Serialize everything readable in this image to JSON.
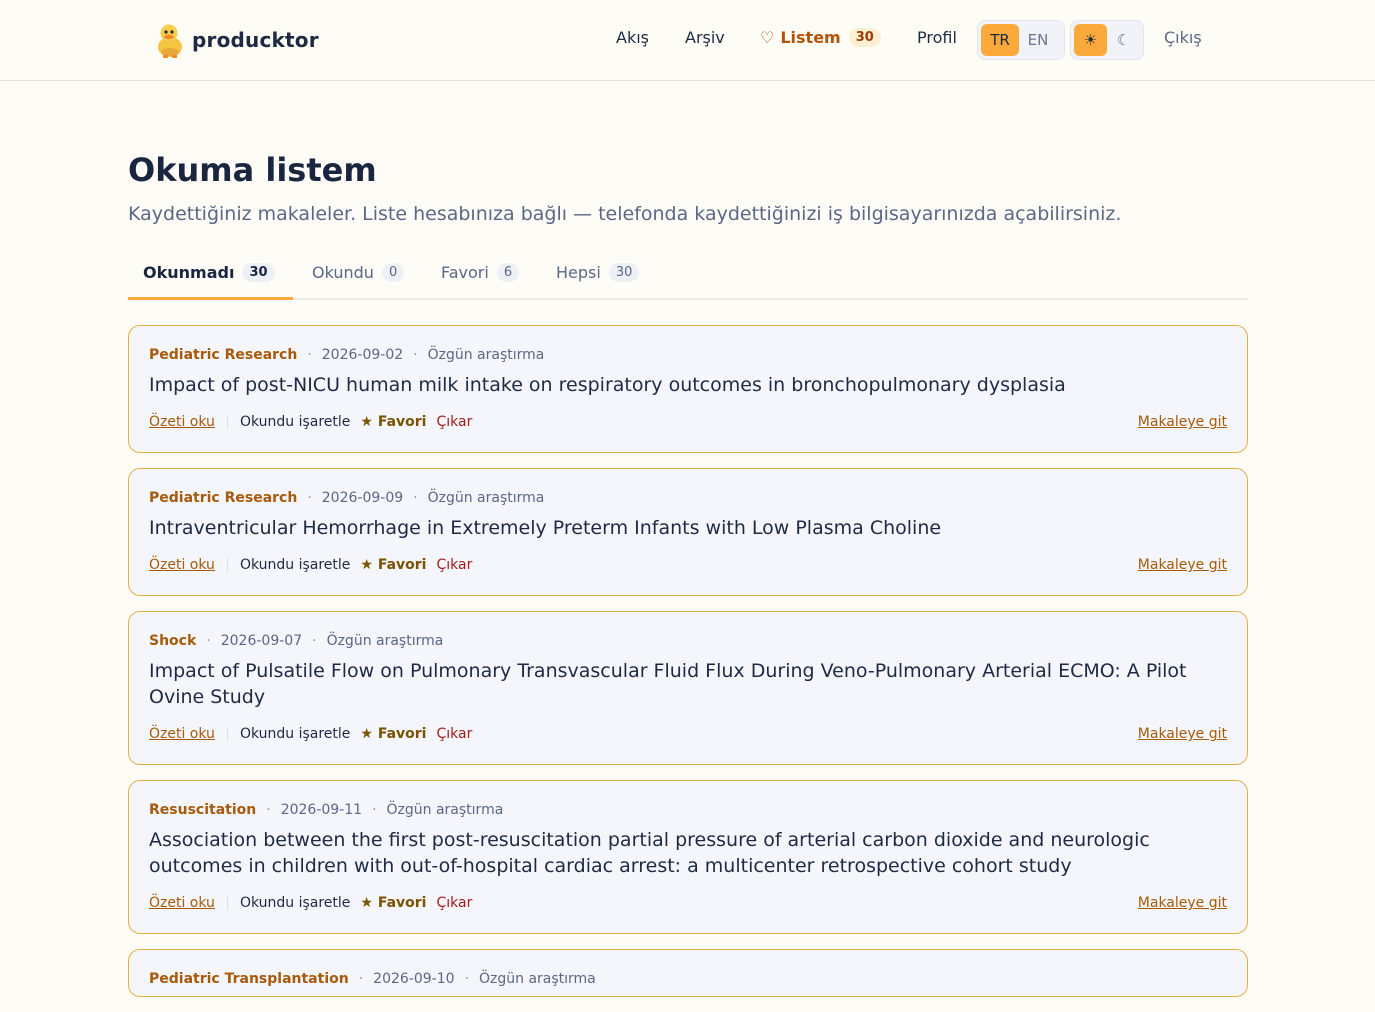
{
  "header": {
    "brand": "producktor",
    "nav": {
      "feed": "Akış",
      "archive": "Arşiv",
      "mylist": "Listem",
      "mylist_count": "30",
      "profile": "Profil",
      "logout": "Çıkış"
    },
    "lang": {
      "tr": "TR",
      "en": "EN",
      "selected": "TR"
    },
    "theme": {
      "light_icon": "☀",
      "dark_icon": "☾",
      "selected": "light"
    }
  },
  "page": {
    "title": "Okuma listem",
    "subtitle": "Kaydettiğiniz makaleler. Liste hesabınıza bağlı — telefonda kaydettiğinizi iş bilgisayarınızda açabilirsiniz."
  },
  "tabs": [
    {
      "label": "Okunmadı",
      "count": "30",
      "active": true
    },
    {
      "label": "Okundu",
      "count": "0"
    },
    {
      "label": "Favori",
      "count": "6"
    },
    {
      "label": "Hepsi",
      "count": "30"
    }
  ],
  "actions": {
    "read_summary": "Özeti oku",
    "mark_read": "Okundu işaretle",
    "favorite": "★ Favori",
    "remove": "Çıkar",
    "go_to_article": "Makaleye git"
  },
  "articles": [
    {
      "journal": "Pediatric Research",
      "date": "2026-09-02",
      "type": "Özgün araştırma",
      "title": "Impact of post-NICU human milk intake on respiratory outcomes in bronchopulmonary dysplasia"
    },
    {
      "journal": "Pediatric Research",
      "date": "2026-09-09",
      "type": "Özgün araştırma",
      "title": "Intraventricular Hemorrhage in Extremely Preterm Infants with Low Plasma Choline"
    },
    {
      "journal": "Shock",
      "date": "2026-09-07",
      "type": "Özgün araştırma",
      "title": "Impact of Pulsatile Flow on Pulmonary Transvascular Fluid Flux During Veno-Pulmonary Arterial ECMO: A Pilot Ovine Study"
    },
    {
      "journal": "Resuscitation",
      "date": "2026-09-11",
      "type": "Özgün araştırma",
      "title": "Association between the first post-resuscitation partial pressure of arterial carbon dioxide and neurologic outcomes in children with out-of-hospital cardiac arrest: a multicenter retrospective cohort study"
    },
    {
      "journal": "Pediatric Transplantation",
      "date": "2026-09-10",
      "type": "Özgün araştırma",
      "title": ""
    }
  ],
  "colors": {
    "accent": "#fba93a",
    "journal": "#a85a0a",
    "card_border": "#e2b040",
    "remove": "#a61b1b"
  }
}
